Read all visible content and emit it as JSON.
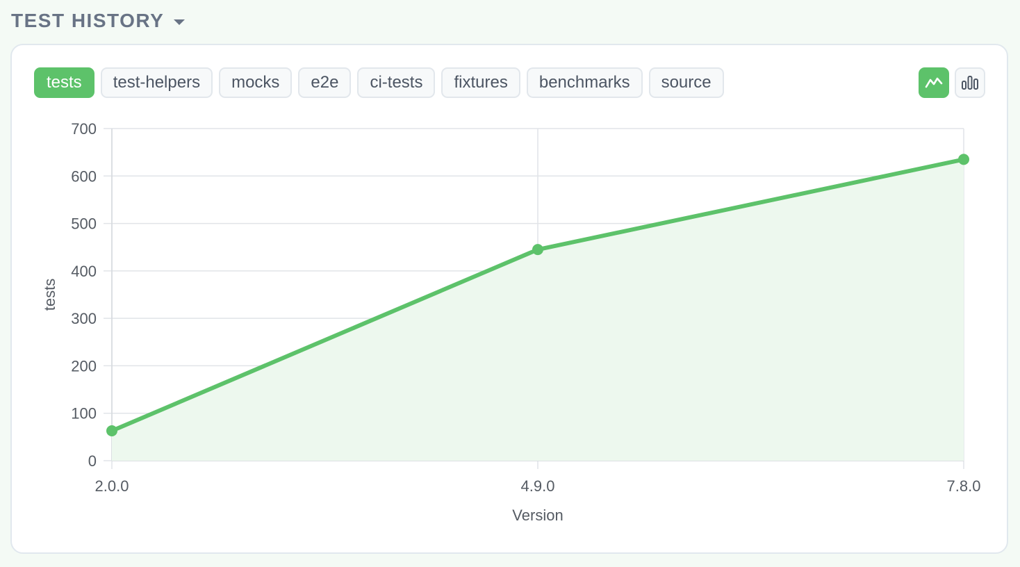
{
  "header": {
    "title": "TEST HISTORY",
    "caret_icon": "caret-down-icon"
  },
  "tabs": [
    {
      "label": "tests",
      "active": true
    },
    {
      "label": "test-helpers",
      "active": false
    },
    {
      "label": "mocks",
      "active": false
    },
    {
      "label": "e2e",
      "active": false
    },
    {
      "label": "ci-tests",
      "active": false
    },
    {
      "label": "fixtures",
      "active": false
    },
    {
      "label": "benchmarks",
      "active": false
    },
    {
      "label": "source",
      "active": false
    }
  ],
  "view_toggle": [
    {
      "icon": "line-chart-icon",
      "active": true
    },
    {
      "icon": "bar-chart-icon",
      "active": false
    }
  ],
  "colors": {
    "accent": "#5dc26a",
    "fill": "#edf8ee",
    "grid": "#e1e4e8",
    "text": "#555b63"
  },
  "chart_data": {
    "type": "area",
    "categories": [
      "2.0.0",
      "4.9.0",
      "7.8.0"
    ],
    "series": [
      {
        "name": "tests",
        "values": [
          63,
          445,
          635
        ]
      }
    ],
    "xlabel": "Version",
    "ylabel": "tests",
    "ylim": [
      0,
      700
    ],
    "yticks": [
      0,
      100,
      200,
      300,
      400,
      500,
      600,
      700
    ],
    "grid": true,
    "legend": "none"
  }
}
